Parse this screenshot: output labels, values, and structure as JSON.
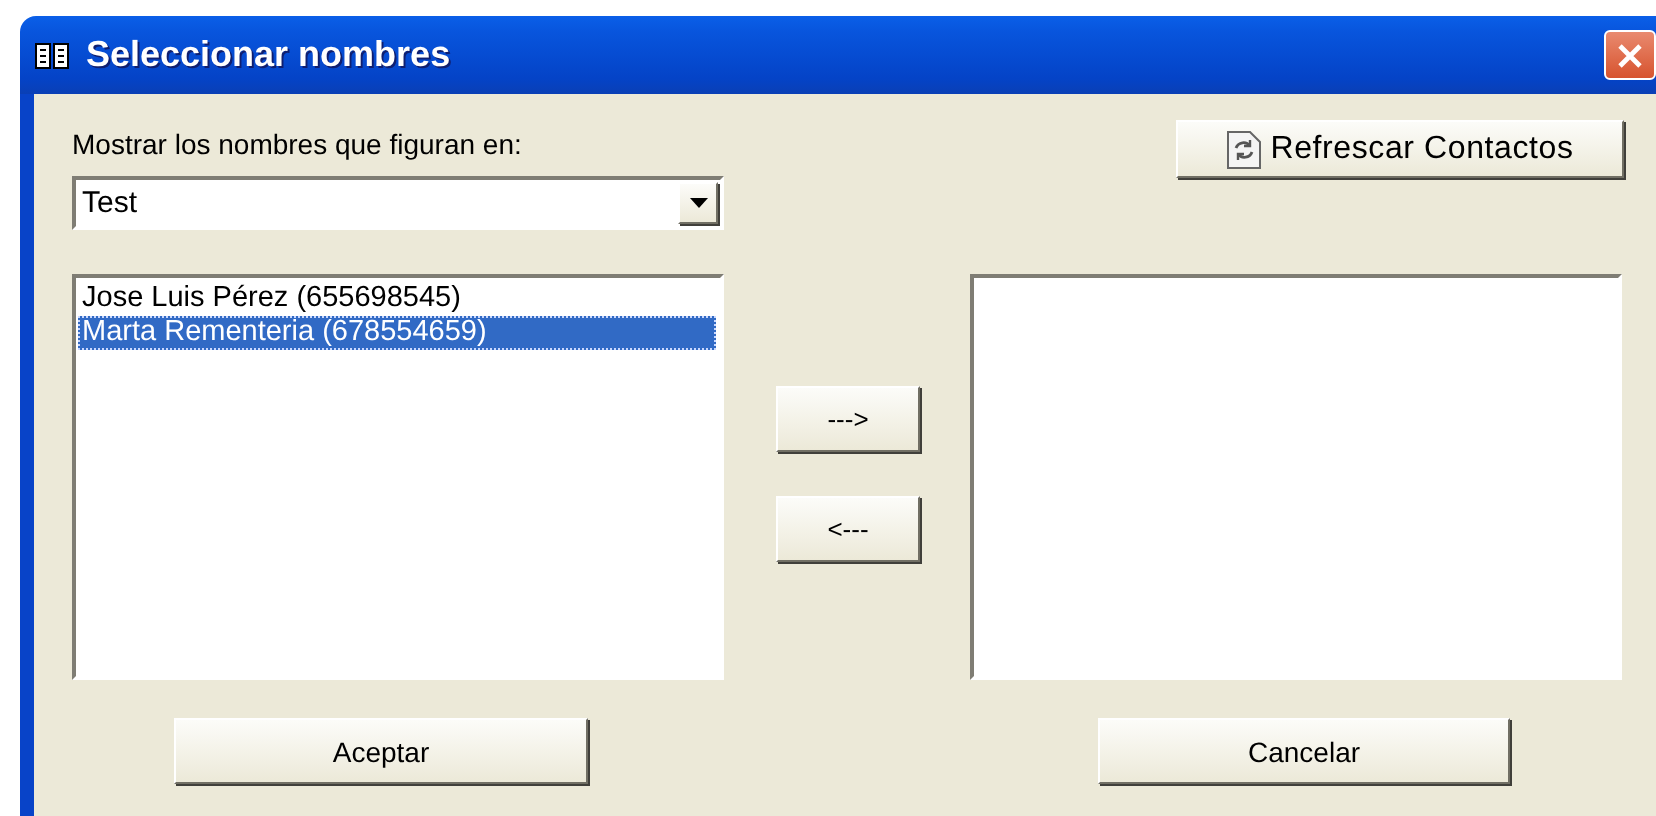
{
  "window": {
    "title": "Seleccionar nombres"
  },
  "source_label": "Mostrar los nombres que figuran en:",
  "source_combo": {
    "value": "Test"
  },
  "refresh_button": {
    "label": "Refrescar Contactos"
  },
  "available_list": {
    "items": [
      {
        "label": "Jose Luis Pérez (655698545)",
        "selected": false
      },
      {
        "label": "Marta Rementeria (678554659)",
        "selected": true
      }
    ]
  },
  "move_buttons": [
    {
      "label": "--->"
    },
    {
      "label": "<---"
    }
  ],
  "buttons": [
    {
      "label": "Aceptar"
    },
    {
      "label": "Cancelar"
    }
  ]
}
